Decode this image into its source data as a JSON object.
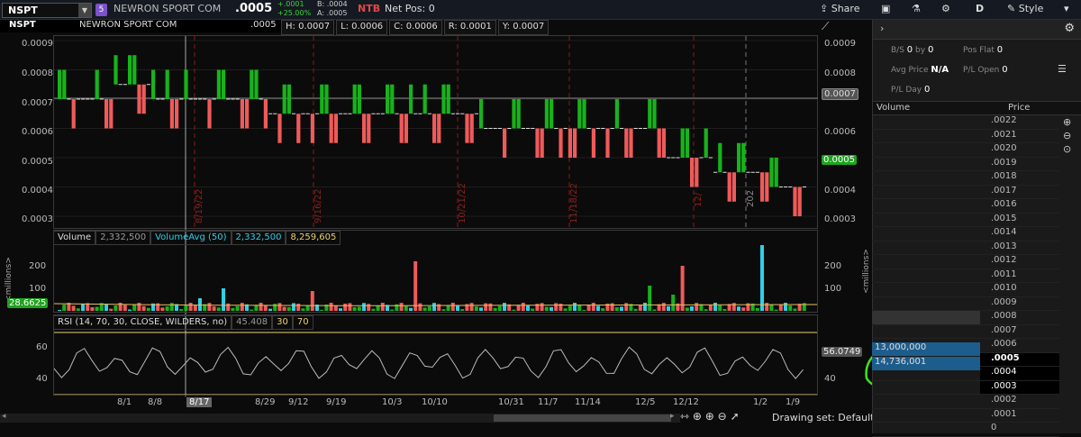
{
  "topbar": {
    "symbol": "NSPT",
    "desc": "NEWRON SPORT COM",
    "last": ".0005",
    "chg": "+.0001",
    "pct": "+25.00%",
    "bid": "B: .0004",
    "ask": "A: .0005",
    "ntb": "NTB",
    "netpos": "Net Pos: 0",
    "share": "Share",
    "d": "D",
    "style": "Style"
  },
  "ticker_tooltip": {
    "symbol": "NSPT",
    "desc": "NEWRON SPORT COM",
    "price": ".0005"
  },
  "ohlc": {
    "h": "H: 0.0007",
    "l": "L: 0.0006",
    "c": "C: 0.0006",
    "r": "R: 0.0001",
    "y": "Y: 0.0007"
  },
  "price_axis_left": [
    "0.0009",
    "0.0008",
    "0.0007",
    "0.0006",
    "0.0005",
    "0.0004",
    "0.0003"
  ],
  "price_axis_right": [
    "0.0009",
    "0.0008",
    "0.0007",
    "0.0006",
    "0.0005",
    "0.0004",
    "0.0003"
  ],
  "price_labels": {
    "prev": "0.0007",
    "last": "0.0005"
  },
  "date_markers": [
    "8/19/22",
    "9/16/22",
    "10/21/22",
    "11/18/22",
    "12/",
    "202"
  ],
  "volume": {
    "title": "Volume",
    "val": "2,332,500",
    "avg_label": "VolumeAvg (50)",
    "avg_val": "2,332,500",
    "other": "8,259,605",
    "ticks_left": [
      "200",
      "100"
    ],
    "ticks_right": [
      "200",
      "100"
    ],
    "units": "<millions>",
    "badge": "28.6625"
  },
  "rsi": {
    "title": "RSI (14, 70, 30, CLOSE, WILDERS, no)",
    "val": "45.408",
    "os": "30",
    "ob": "70",
    "ticks_left": [
      "60",
      "40"
    ],
    "ticks_right": [
      "60",
      "40"
    ],
    "badge": "56.0749"
  },
  "x_axis": [
    "8/1",
    "8/8",
    "8/17",
    "8/29",
    "9/12",
    "9/19",
    "10/3",
    "10/10",
    "10/31",
    "11/7",
    "11/14",
    "12/5",
    "12/12",
    "1/2",
    "1/9"
  ],
  "drawing_set": "Drawing set: Default",
  "right_panel": {
    "bs": "B/S",
    "bs_val": "0",
    "by": "by",
    "by_val": "0",
    "posflat": "Pos Flat",
    "posflat_val": "0",
    "avgprice": "Avg Price",
    "avgprice_val": "N/A",
    "plopen": "P/L Open",
    "plopen_val": "0",
    "plday": "P/L Day",
    "plday_val": "0",
    "vol_hdr": "Volume",
    "price_hdr": "Price",
    "prices": [
      ".0022",
      ".0021",
      ".0020",
      ".0019",
      ".0018",
      ".0017",
      ".0016",
      ".0015",
      ".0014",
      ".0013",
      ".0012",
      ".0011",
      ".0010",
      ".0009",
      ".0008",
      ".0007",
      ".0006",
      ".0005",
      ".0004",
      ".0003",
      ".0002",
      ".0001",
      "0"
    ],
    "bids": {
      "p0005": "13,000,000",
      "p0004": "14,736,001"
    }
  },
  "colors": {
    "up": "#17b31b",
    "down": "#f05a5a",
    "accent": "#00c8ff",
    "annotation": "#37e81b"
  }
}
